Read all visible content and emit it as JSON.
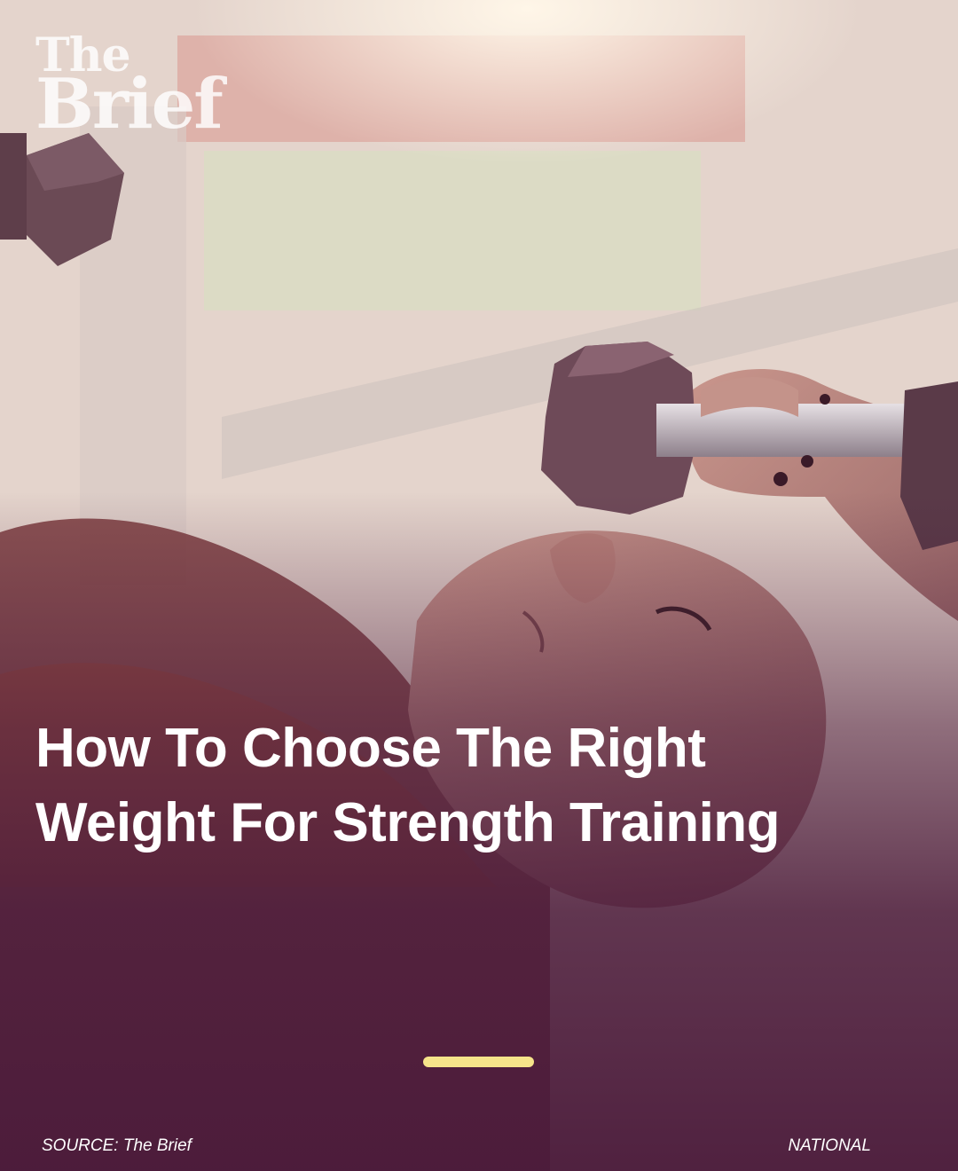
{
  "brand": {
    "logo_line1": "The",
    "logo_line2": "Brief"
  },
  "headline": "How To Choose The Right Weight For Strength Training",
  "slide_indicator": {
    "color": "#f6e48a"
  },
  "footer": {
    "source": "SOURCE: The Brief",
    "category": "NATIONAL"
  },
  "colors": {
    "overlay": "#4a1a3a",
    "text": "#ffffff"
  },
  "image": {
    "description": "woman lying on bench lifting dumbbells in gym"
  }
}
